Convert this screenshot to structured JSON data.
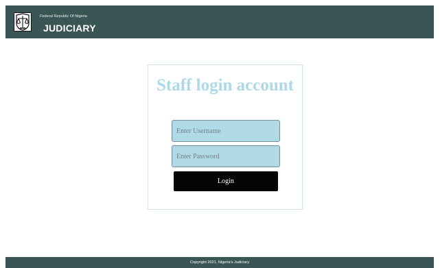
{
  "header": {
    "subtitle": "Federal Republic Of Nigeria",
    "title": "JUDICIARY",
    "logo_icon": "scales-of-justice-crest-icon"
  },
  "login": {
    "heading": "Staff login account",
    "username_placeholder": "Enter Username",
    "password_placeholder": "Enter Password",
    "button_label": "Login"
  },
  "footer": {
    "copyright": "Copyright 2021, Nigeria's Judiciary"
  },
  "colors": {
    "header_bg": "#3a5654",
    "footer_bg": "#3a5654",
    "heading": "#acd8e8",
    "input_bg": "#b0dbe6",
    "button_bg": "#050505"
  }
}
